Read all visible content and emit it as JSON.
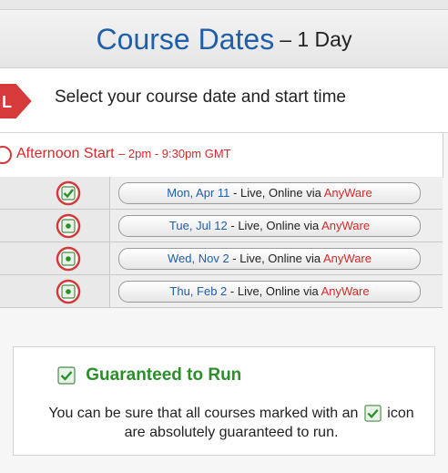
{
  "header": {
    "title": "Course Dates",
    "subtitle": "– 1 Day"
  },
  "select_prompt": "Select your course date and start time",
  "afternoon": {
    "label": "Afternoon Start",
    "time": "– 2pm - 9:30pm GMT"
  },
  "dates": [
    {
      "date": "Mon, Apr 11",
      "mode": " - Live, Online via ",
      "brand": "AnyWare",
      "icon": "guaranteed-check-icon"
    },
    {
      "date": "Tue, Jul 12",
      "mode": " - Live, Online via ",
      "brand": "AnyWare",
      "icon": "radio-dot-icon"
    },
    {
      "date": "Wed, Nov 2",
      "mode": " - Live, Online via ",
      "brand": "AnyWare",
      "icon": "radio-dot-icon"
    },
    {
      "date": "Thu, Feb 2",
      "mode": " - Live, Online via ",
      "brand": "AnyWare",
      "icon": "radio-dot-icon"
    }
  ],
  "guarantee": {
    "title": "Guaranteed to Run",
    "text_before": "You can be sure that all courses marked with an",
    "text_after": "icon are absolutely guaranteed to run."
  },
  "colors": {
    "accent_blue": "#1f5fa8",
    "brand_red": "#d62828",
    "guarantee_green": "#2a8f2a"
  }
}
